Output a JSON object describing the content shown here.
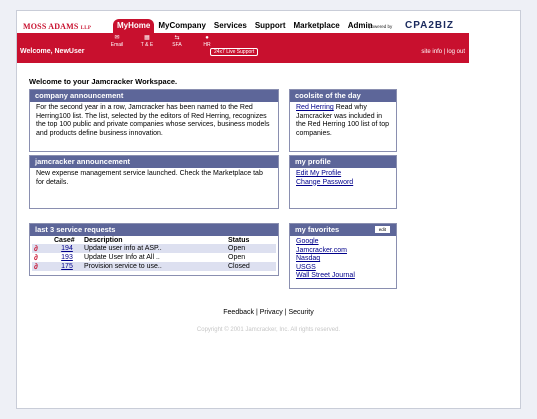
{
  "logo": {
    "name": "MOSS ADAMS",
    "suffix": "LLP"
  },
  "nav": {
    "items": [
      "MyHome",
      "MyCompany",
      "Services",
      "Support",
      "Marketplace",
      "Admin"
    ]
  },
  "powered_by": "powered by",
  "brand": "CPA2BIZ",
  "subnav": [
    {
      "label": "Email",
      "icon": "envelope-icon",
      "glyph": "✉"
    },
    {
      "label": "T & E",
      "icon": "calendar-icon",
      "glyph": "▦"
    },
    {
      "label": "SFA",
      "icon": "arrows-icon",
      "glyph": "⇆"
    },
    {
      "label": "HR",
      "icon": "person-icon",
      "glyph": "●"
    }
  ],
  "welcome": "Welcome, NewUser",
  "live_support": "24x7 Live Support",
  "toplinks": {
    "site_info": "site info",
    "separator": "|",
    "log_out": "log out"
  },
  "intro": "Welcome to your Jamcracker Workspace.",
  "company_announcement": {
    "title": "company announcement",
    "body": "For the second year in a row, Jamcracker has been named to the Red Herring100 list.  The list, selected by the editors of Red Herring, recognizes the top 100 public and private companies whose services, business models and products define business innovation."
  },
  "coolsite": {
    "title": "coolsite of the day",
    "link": "Red Herring",
    "body": " Read why Jamcracker was included in the Red Herring 100 list of top companies."
  },
  "jamcracker_announcement": {
    "title": "jamcracker announcement",
    "body": "New expense management service launched.  Check the Marketplace tab for details."
  },
  "profile": {
    "title": "my profile",
    "links": [
      "Edit My Profile",
      "Change Password"
    ]
  },
  "service_requests": {
    "title": "last 3 service requests",
    "headers": {
      "case": "Case#",
      "description": "Description",
      "status": "Status"
    },
    "rows": [
      {
        "case": "194",
        "description": "Update user info at ASP..",
        "status": "Open"
      },
      {
        "case": "193",
        "description": "Update User Info at All ..",
        "status": "Open"
      },
      {
        "case": "175",
        "description": "Provision service to use..",
        "status": "Closed"
      }
    ]
  },
  "favorites": {
    "title": "my favorites",
    "edit": "edit",
    "links": [
      "Google",
      "Jamcracker.com",
      "Nasdaq",
      "USGS",
      "Wall Street Journal"
    ]
  },
  "footer": {
    "feedback": "Feedback",
    "privacy": "Privacy",
    "security": "Security",
    "sep": "|"
  },
  "copyright": "Copyright © 2001 Jamcracker, Inc. All rights reserved.",
  "colors": {
    "brand_red": "#c8102e",
    "panel_header": "#5d6699",
    "link": "#00008b"
  }
}
